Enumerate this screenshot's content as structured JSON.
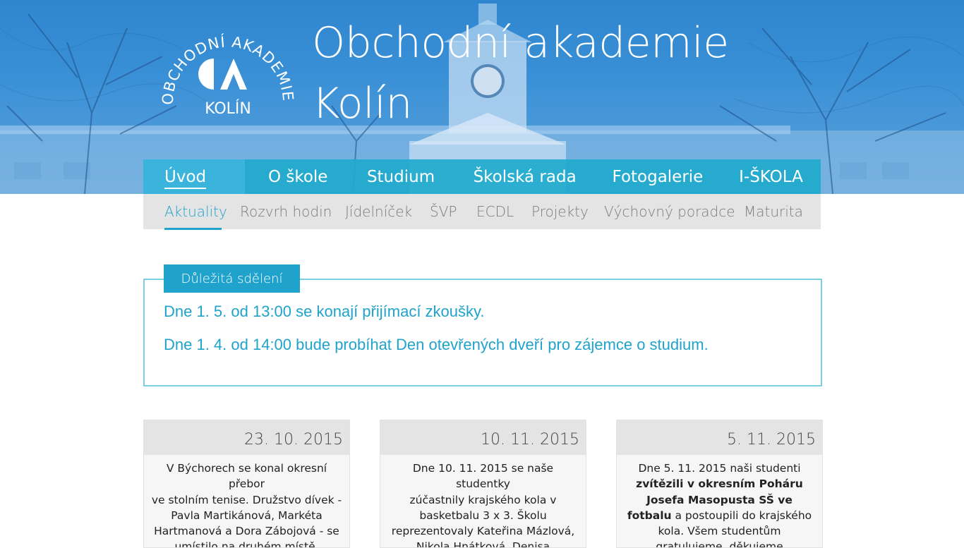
{
  "header": {
    "logo": {
      "arc_text": "OBCHODNÍ AKADEMIE",
      "monogram": "OA",
      "bottom_text": "KOLÍN"
    },
    "title_line1": "Obchodní akademie",
    "title_line2": "Kolín"
  },
  "main_nav": [
    {
      "label": "Úvod",
      "active": true
    },
    {
      "label": "O škole"
    },
    {
      "label": "Studium"
    },
    {
      "label": "Školská rada"
    },
    {
      "label": "Fotogalerie"
    },
    {
      "label": "I-ŠKOLA"
    }
  ],
  "sub_nav": [
    {
      "label": "Aktuality",
      "active": true
    },
    {
      "label": "Rozvrh hodin"
    },
    {
      "label": "Jídelníček"
    },
    {
      "label": "ŠVP"
    },
    {
      "label": "ECDL"
    },
    {
      "label": "Projekty"
    },
    {
      "label": "Výchovný poradce"
    },
    {
      "label": "Maturita"
    }
  ],
  "notice": {
    "title": "Důležitá sdělení",
    "lines": [
      "Dne 1. 5. od 13:00 se konají přijímací zkoušky.",
      "Dne 1. 4. od 14:00 bude probíhat Den otevřených dveří pro zájemce o studium."
    ]
  },
  "news": [
    {
      "date": "23. 10. 2015",
      "text_lines": [
        "V Býchorech se konal okresní přebor",
        "ve stolním tenise. Družstvo dívek -",
        "Pavla Martikánová, Markéta",
        "Hartmanová a Dora Zábojová - se",
        "umístilo na druhém místě. Družstvo"
      ]
    },
    {
      "date": "10. 11. 2015",
      "text_lines": [
        "Dne 10. 11. 2015 se naše studentky",
        "zúčastnily krajského kola v",
        "basketbalu 3 x 3. Školu",
        "reprezentovaly Kateřina Mázlová,",
        "Nikola Hnátková, Denisa"
      ]
    },
    {
      "date": "5. 11. 2015",
      "text_intro": "Dne 5. 11. 2015 naši studenti",
      "text_bold": "zvítězili v okresním Poháru Josefa Masopusta SŠ ve fotbalu",
      "text_rest": "a postoupili do krajského kola. Všem studentům gratulujeme, děkujeme"
    }
  ],
  "colors": {
    "accent": "#1fa3cc",
    "nav_bg": "#1faacd",
    "subnav_bg": "#e4e4e4",
    "hero_blue": "#3a90d6"
  }
}
